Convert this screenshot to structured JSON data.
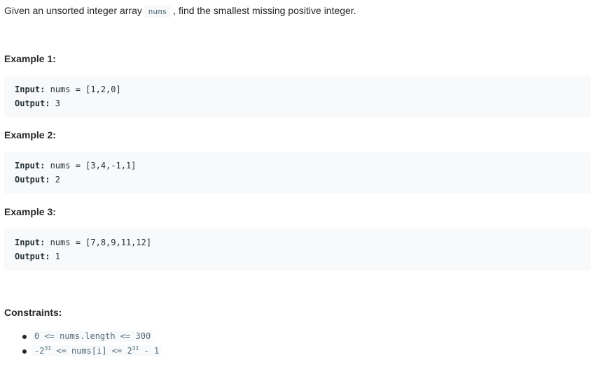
{
  "intro": {
    "before": "Given an unsorted integer array ",
    "code": "nums",
    "after": " , find the smallest missing positive integer."
  },
  "examples": [
    {
      "title": "Example 1:",
      "input_label": "Input:",
      "input_value": " nums = [1,2,0]",
      "output_label": "Output:",
      "output_value": " 3"
    },
    {
      "title": "Example 2:",
      "input_label": "Input:",
      "input_value": " nums = [3,4,-1,1]",
      "output_label": "Output:",
      "output_value": " 2"
    },
    {
      "title": "Example 3:",
      "input_label": "Input:",
      "input_value": " nums = [7,8,9,11,12]",
      "output_label": "Output:",
      "output_value": " 1"
    }
  ],
  "constraints": {
    "title": "Constraints:",
    "c1": "0 <= nums.length <= 300",
    "c2": {
      "part1": "-2",
      "exp1": "31",
      "part2": " <= nums[i] <= 2",
      "exp2": "31",
      "part3": " - 1"
    }
  }
}
